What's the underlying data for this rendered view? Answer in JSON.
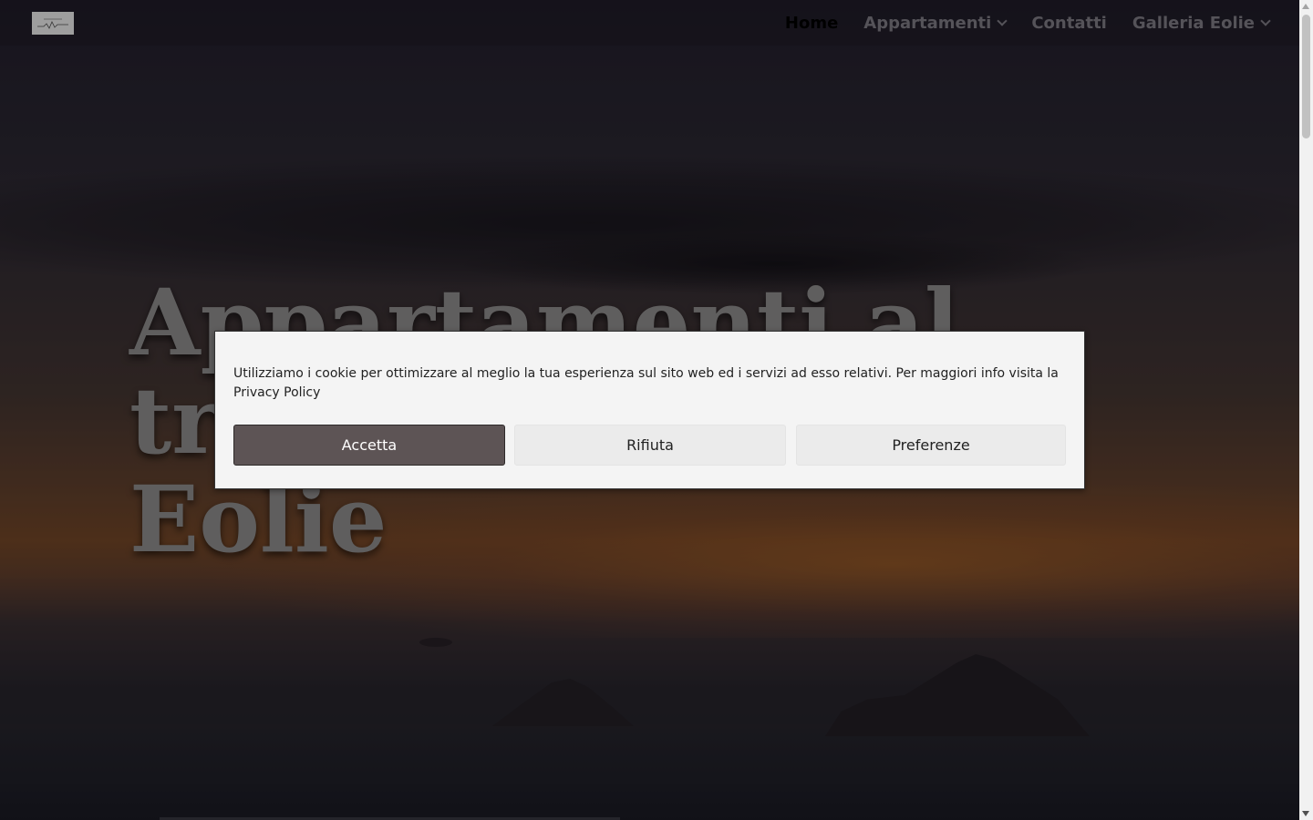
{
  "header": {
    "nav": [
      {
        "label": "Home",
        "active": true,
        "has_dropdown": false
      },
      {
        "label": "Appartamenti",
        "active": false,
        "has_dropdown": true
      },
      {
        "label": "Contatti",
        "active": false,
        "has_dropdown": false
      },
      {
        "label": "Galleria Eolie",
        "active": false,
        "has_dropdown": true
      }
    ],
    "logo_icon": "site-logo"
  },
  "hero": {
    "title": "Appartamenti al tramonto sulle Eolie"
  },
  "cookie_banner": {
    "text": "Utilizziamo i cookie per ottimizzare al meglio la tua esperienza sul sito web ed i servizi ad esso relativi. Per maggiori info visita la Privacy Policy",
    "accept_label": "Accetta",
    "reject_label": "Rifiuta",
    "preferences_label": "Preferenze",
    "colors": {
      "accept_bg": "#5d5455",
      "secondary_bg": "#ebebeb",
      "banner_bg": "#f4f4f4"
    }
  }
}
